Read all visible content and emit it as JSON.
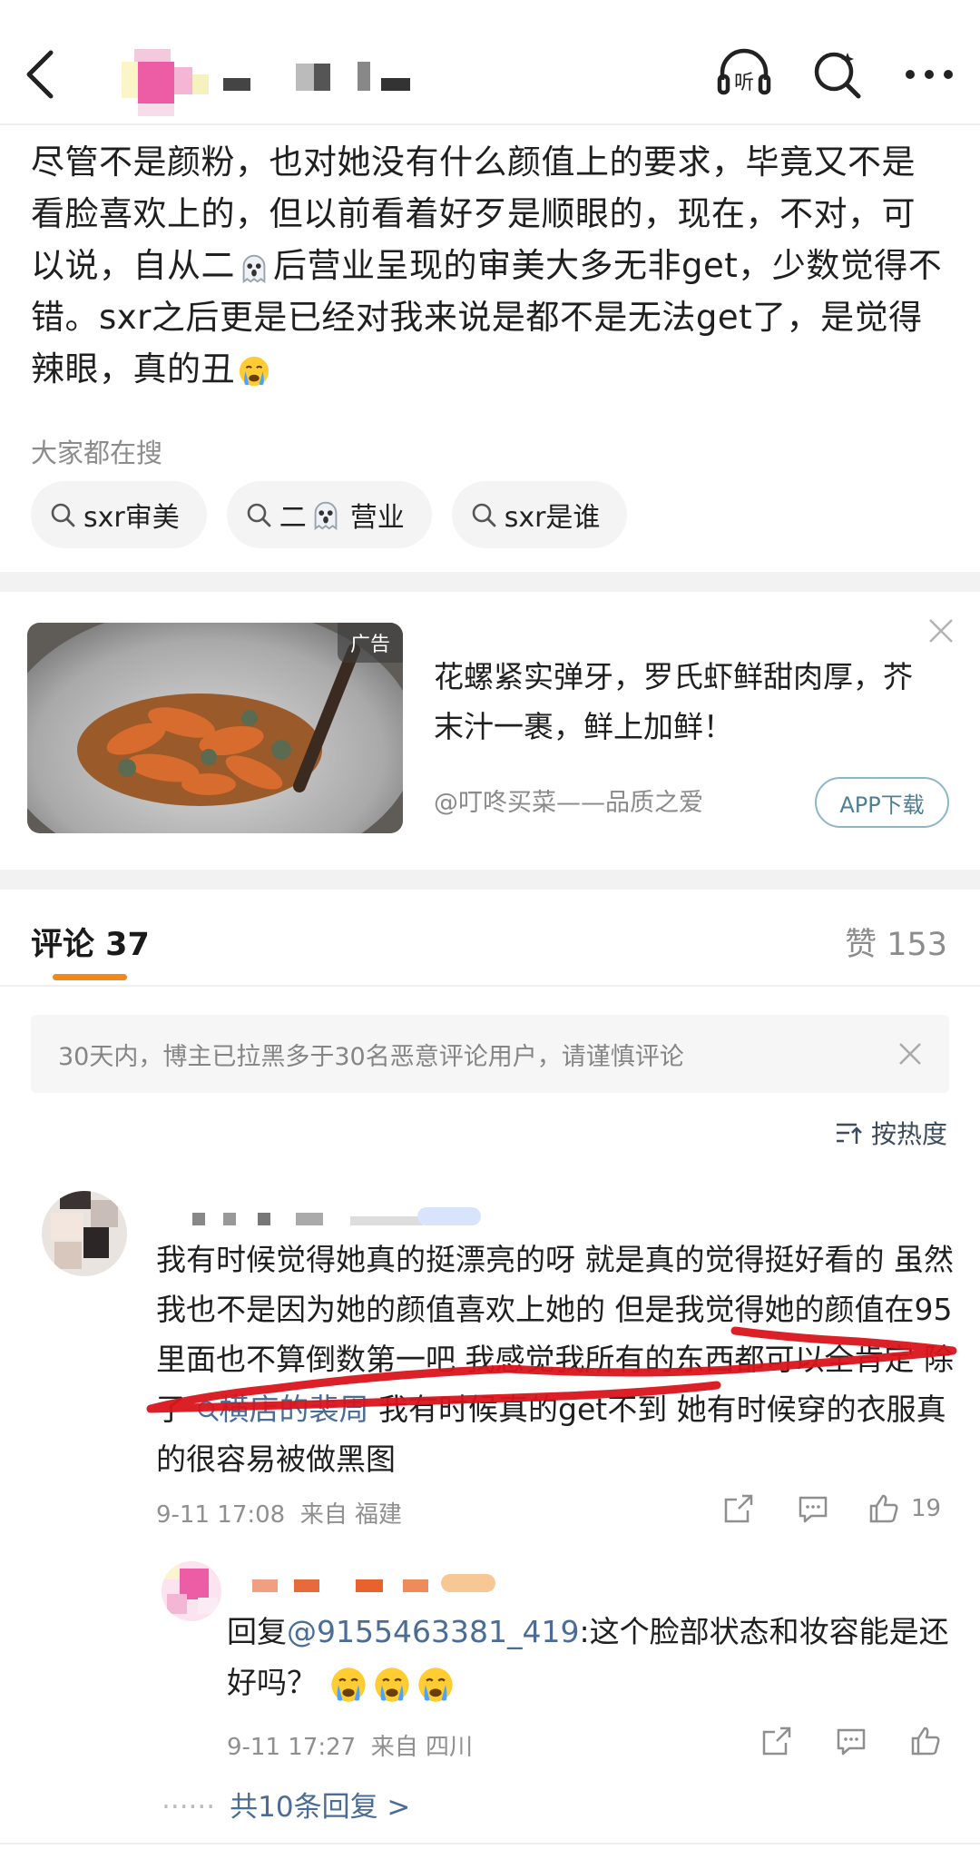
{
  "header": {
    "listen_label": "听"
  },
  "post": {
    "text_parts": [
      "尽管不是颜粉，也对她没有什么颜值上的要求，毕竟又不是看脸喜欢上的，但以前看着好歹是顺眼的，现在，不对，可以说，自从二",
      "后营业呈现的审美大多无非get，少数觉得不错。sxr之后更是已经对我来说是都不是无法get了，是觉得辣眼，真的丑"
    ]
  },
  "hot_search": {
    "title": "大家都在搜",
    "chips": [
      {
        "pre": "sxr审美",
        "post": ""
      },
      {
        "pre": "二",
        "post": "营业"
      },
      {
        "pre": "sxr是谁",
        "post": ""
      }
    ]
  },
  "ad": {
    "tag": "广告",
    "text": "花螺紧实弹牙，罗氏虾鲜甜肉厚，芥末汁一裹，鲜上加鲜！",
    "source": "@叮咚买菜——品质之爱",
    "button": "APP下载"
  },
  "comments": {
    "title": "评论 37",
    "likes": "赞 153",
    "notice": "30天内，博主已拉黑多于30名恶意评论用户，请谨慎评论",
    "sort_label": "按热度",
    "first": {
      "text_a": "我有时候觉得她真的挺漂亮的呀 就是真的觉得挺好看的 虽然我也不是因为她的颜值喜欢上她的 但是我觉得她的颜值在95里面也不算倒数第一吧 我感觉我所有的东西都可以全肯定 除了",
      "mention": "横店的裴周",
      "text_b": "我有时候真的get不到 她有时候穿的衣服真的很容易被做黑图",
      "time": "9-11 17:08",
      "location": "来自 福建",
      "like_count": "19"
    },
    "reply": {
      "prefix": "回复",
      "mention": "@9155463381_419",
      "text": ":这个脸部状态和妆容能是还好吗？",
      "time": "9-11 17:27",
      "location": "来自 四川"
    },
    "more_replies": "共10条回复 >"
  }
}
